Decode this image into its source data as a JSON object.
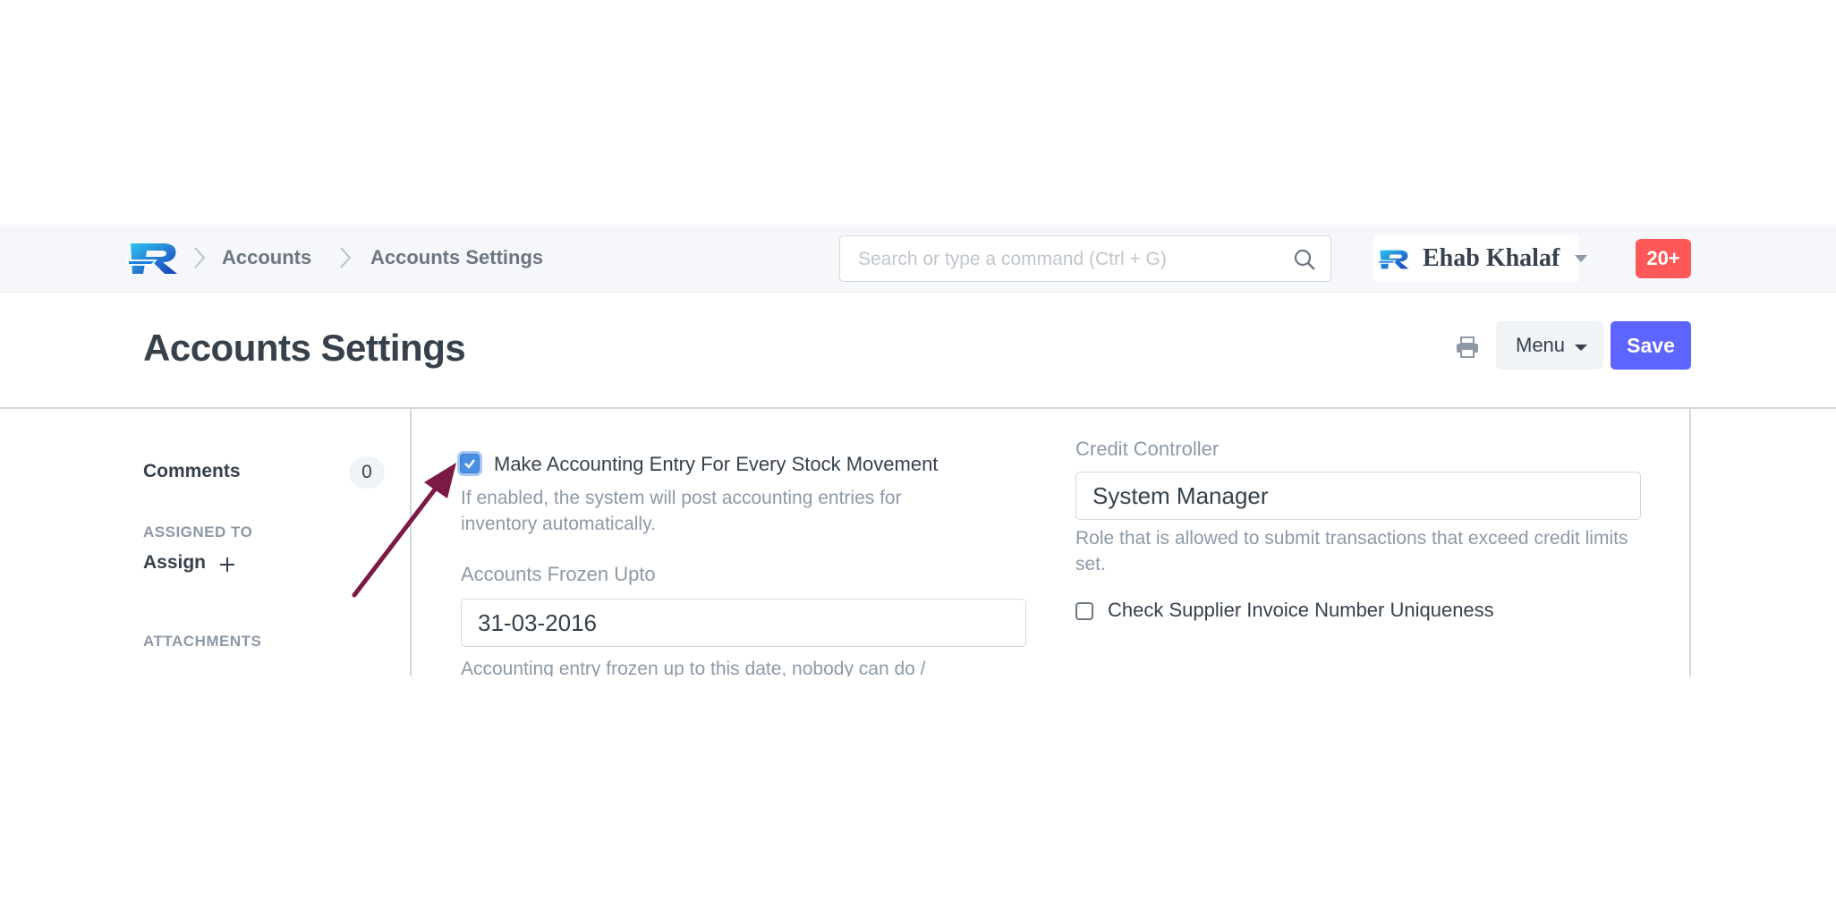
{
  "navbar": {
    "breadcrumbs": [
      "Accounts",
      "Accounts Settings"
    ],
    "search_placeholder": "Search or type a command (Ctrl + G)",
    "user_name": "Ehab Khalaf",
    "notifications_badge": "20+"
  },
  "page": {
    "title": "Accounts Settings",
    "menu_label": "Menu",
    "save_label": "Save"
  },
  "sidebar": {
    "comments_label": "Comments",
    "comments_count": "0",
    "assigned_to_heading": "ASSIGNED TO",
    "assign_label": "Assign",
    "attachments_heading": "ATTACHMENTS"
  },
  "form": {
    "make_accounting_entry": {
      "label": "Make Accounting Entry For Every Stock Movement",
      "checked": true,
      "help": "If enabled, the system will post accounting entries for inventory automatically."
    },
    "accounts_frozen_upto": {
      "label": "Accounts Frozen Upto",
      "value": "31-03-2016",
      "help": "Accounting entry frozen up to this date, nobody can do /"
    },
    "credit_controller": {
      "label": "Credit Controller",
      "value": "System Manager",
      "help": "Role that is allowed to submit transactions that exceed credit limits set."
    },
    "check_supplier_invoice": {
      "label": "Check Supplier Invoice Number Uniqueness",
      "checked": false
    }
  },
  "colors": {
    "primary": "#5e64ff",
    "badge": "#ff5858",
    "annotation_arrow": "#7a1a45",
    "navbar_bg": "#f5f7fa"
  }
}
